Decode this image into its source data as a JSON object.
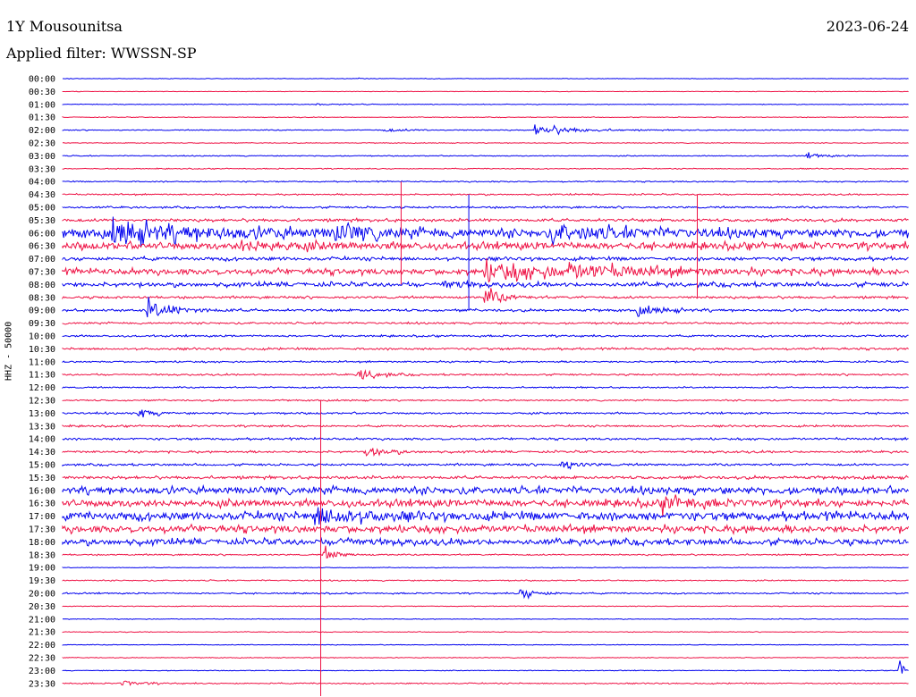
{
  "header": {
    "station": "1Y Mousounitsa",
    "date": "2023-06-24",
    "filter": "Applied filter: WWSSN-SP"
  },
  "chart_data": {
    "type": "line",
    "title": "1Y Mousounitsa",
    "ylabel": "HHZ - 50000",
    "colors": [
      "#0000ee",
      "#ee1144"
    ],
    "rows": [
      "00:00",
      "00:30",
      "01:00",
      "01:30",
      "02:00",
      "02:30",
      "03:00",
      "03:30",
      "04:00",
      "04:30",
      "05:00",
      "05:30",
      "06:00",
      "06:30",
      "07:00",
      "07:30",
      "08:00",
      "08:30",
      "09:00",
      "09:30",
      "10:00",
      "10:30",
      "11:00",
      "11:30",
      "12:00",
      "12:30",
      "13:00",
      "13:30",
      "14:00",
      "14:30",
      "15:00",
      "15:30",
      "16:00",
      "16:30",
      "17:00",
      "17:30",
      "18:00",
      "18:30",
      "19:00",
      "19:30",
      "20:00",
      "20:30",
      "21:00",
      "21:30",
      "22:00",
      "22:30",
      "23:00",
      "23:30"
    ],
    "noise": [
      0.2,
      0.2,
      0.3,
      0.3,
      0.4,
      0.3,
      0.4,
      0.4,
      0.5,
      0.6,
      0.8,
      1.2,
      3.5,
      3.0,
      1.5,
      2.5,
      1.8,
      1.0,
      1.0,
      0.8,
      0.8,
      0.9,
      0.7,
      0.7,
      0.6,
      0.6,
      0.8,
      0.8,
      0.9,
      0.9,
      0.9,
      1.2,
      3.0,
      3.0,
      3.5,
      3.0,
      2.5,
      0.6,
      0.3,
      0.5,
      0.6,
      0.3,
      0.3,
      0.3,
      0.3,
      0.3,
      0.3,
      0.5
    ],
    "events": [
      {
        "row": "00:00",
        "pos": 0.35,
        "amp": 0.2,
        "len": 0.01
      },
      {
        "row": "00:00",
        "pos": 0.43,
        "amp": 0.6,
        "len": 0.004
      },
      {
        "row": "01:00",
        "pos": 0.3,
        "amp": 0.2,
        "len": 0.03
      },
      {
        "row": "02:00",
        "pos": 0.38,
        "amp": 0.35,
        "len": 0.03
      },
      {
        "row": "02:00",
        "pos": 0.56,
        "amp": 1.3,
        "len": 0.04
      },
      {
        "row": "03:00",
        "pos": 0.88,
        "amp": 0.6,
        "len": 0.02
      },
      {
        "row": "06:00",
        "pos": 0.06,
        "amp": 2.0,
        "len": 0.12
      },
      {
        "row": "06:00",
        "pos": 0.32,
        "amp": 1.6,
        "len": 0.04
      },
      {
        "row": "06:00",
        "pos": 0.58,
        "amp": 1.5,
        "len": 0.08
      },
      {
        "row": "06:30",
        "pos": 0.21,
        "amp": 1.0,
        "len": 0.06
      },
      {
        "row": "07:30",
        "pos": 0.5,
        "amp": 2.0,
        "len": 0.08
      },
      {
        "row": "07:30",
        "pos": 0.6,
        "amp": 1.0,
        "len": 0.1
      },
      {
        "row": "08:00",
        "pos": 0.45,
        "amp": 1.2,
        "len": 0.02
      },
      {
        "row": "08:30",
        "pos": 0.5,
        "amp": 2.0,
        "len": 0.02
      },
      {
        "row": "09:00",
        "pos": 0.1,
        "amp": 2.3,
        "len": 0.03
      },
      {
        "row": "09:00",
        "pos": 0.68,
        "amp": 0.9,
        "len": 0.03
      },
      {
        "row": "11:30",
        "pos": 0.35,
        "amp": 1.6,
        "len": 0.02
      },
      {
        "row": "13:00",
        "pos": 0.09,
        "amp": 1.2,
        "len": 0.015
      },
      {
        "row": "14:30",
        "pos": 0.36,
        "amp": 1.4,
        "len": 0.02
      },
      {
        "row": "15:00",
        "pos": 0.59,
        "amp": 1.2,
        "len": 0.02
      },
      {
        "row": "16:30",
        "pos": 0.71,
        "amp": 1.6,
        "len": 0.03
      },
      {
        "row": "17:00",
        "pos": 0.3,
        "amp": 2.0,
        "len": 0.05
      },
      {
        "row": "18:00",
        "pos": 0.33,
        "amp": 0.9,
        "len": 0.02
      },
      {
        "row": "18:30",
        "pos": 0.31,
        "amp": 1.6,
        "len": 0.015
      },
      {
        "row": "20:00",
        "pos": 0.54,
        "amp": 1.5,
        "len": 0.02
      },
      {
        "row": "23:00",
        "pos": 0.99,
        "amp": 2.0,
        "len": 0.01
      },
      {
        "row": "23:30",
        "pos": 0.07,
        "amp": 0.8,
        "len": 0.02
      }
    ],
    "spikes": [
      {
        "row": "04:30",
        "pos": 0.4,
        "up": 1,
        "down": 7
      },
      {
        "row": "05:00",
        "pos": 0.48,
        "up": 1,
        "down": 8
      },
      {
        "row": "05:30",
        "pos": 0.75,
        "up": 2,
        "down": 6
      },
      {
        "row": "12:30",
        "pos": 0.305,
        "up": 0,
        "down": 23
      }
    ]
  }
}
